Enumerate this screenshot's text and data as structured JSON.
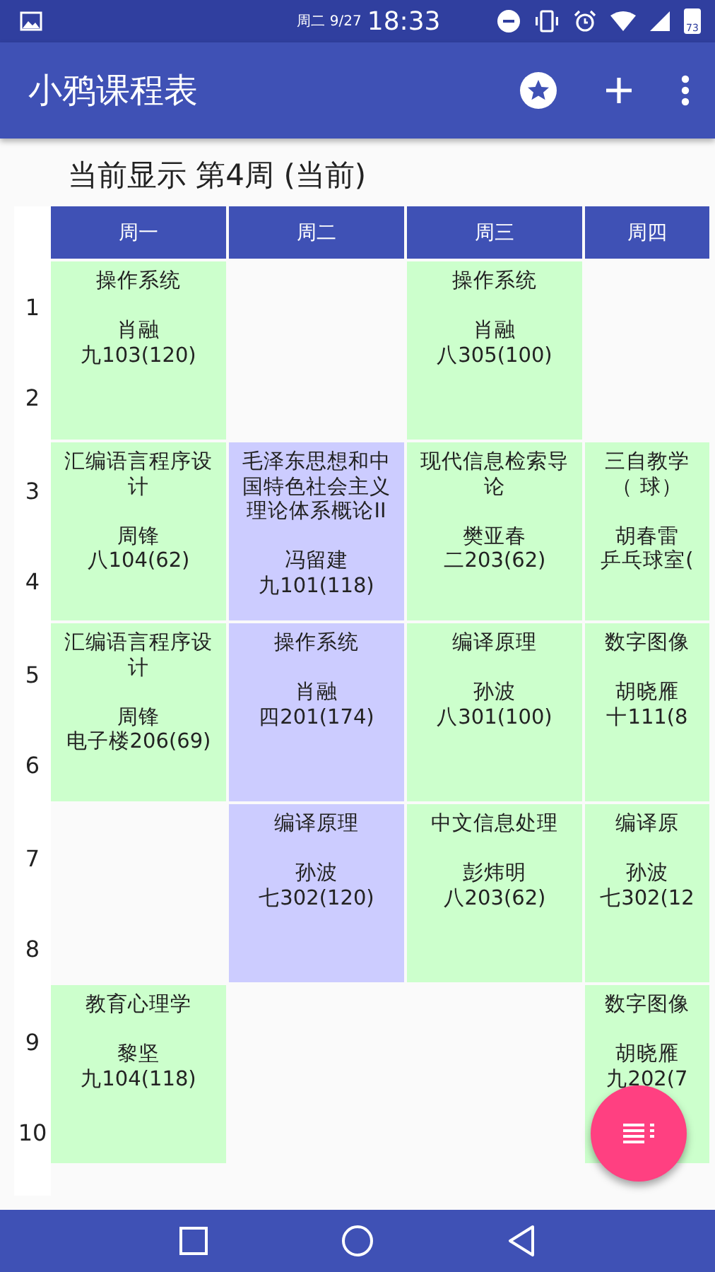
{
  "status_bar": {
    "date": "周二 9/27",
    "time": "18:33",
    "battery": "73"
  },
  "app_bar": {
    "title": "小鸦课程表"
  },
  "week_label": "当前显示 第4周 (当前)",
  "days": [
    "周一",
    "周二",
    "周三",
    "周四"
  ],
  "periods": [
    "1",
    "2",
    "3",
    "4",
    "5",
    "6",
    "7",
    "8",
    "9",
    "10"
  ],
  "blocks": [
    {
      "cells": [
        {
          "kind": "course",
          "color": "#ccffcc",
          "title": "操作系统",
          "teacher": "肖融",
          "room": "九103(120)"
        },
        {
          "kind": "empty"
        },
        {
          "kind": "course",
          "color": "#ccffcc",
          "title": "操作系统",
          "teacher": "肖融",
          "room": "八305(100)"
        },
        {
          "kind": "empty"
        }
      ]
    },
    {
      "cells": [
        {
          "kind": "course",
          "color": "#ccffcc",
          "title": "汇编语言程序设计",
          "teacher": "周锋",
          "room": "八104(62)"
        },
        {
          "kind": "course",
          "color": "#ccccff",
          "title": "毛泽东思想和中国特色社会主义理论体系概论II",
          "teacher": "冯留建",
          "room": "九101(118)"
        },
        {
          "kind": "course",
          "color": "#ccffcc",
          "title": "现代信息检索导论",
          "teacher": "樊亚春",
          "room": "二203(62)"
        },
        {
          "kind": "course",
          "color": "#ccffcc",
          "title": "三自教学（ 球）",
          "teacher": "胡春雷",
          "room": "乒乓球室("
        }
      ]
    },
    {
      "cells": [
        {
          "kind": "course",
          "color": "#ccffcc",
          "title": "汇编语言程序设计",
          "teacher": "周锋",
          "room": "电子楼206(69)"
        },
        {
          "kind": "course",
          "color": "#ccccff",
          "title": "操作系统",
          "teacher": "肖融",
          "room": "四201(174)"
        },
        {
          "kind": "course",
          "color": "#ccffcc",
          "title": "编译原理",
          "teacher": "孙波",
          "room": "八301(100)"
        },
        {
          "kind": "course",
          "color": "#ccffcc",
          "title": "数字图像",
          "teacher": "胡晓雁",
          "room": "十111(8"
        }
      ]
    },
    {
      "cells": [
        {
          "kind": "empty"
        },
        {
          "kind": "course",
          "color": "#ccccff",
          "title": "编译原理",
          "teacher": "孙波",
          "room": "七302(120)"
        },
        {
          "kind": "course",
          "color": "#ccffcc",
          "title": "中文信息处理",
          "teacher": "彭炜明",
          "room": "八203(62)"
        },
        {
          "kind": "course",
          "color": "#ccffcc",
          "title": "编译原",
          "teacher": "孙波",
          "room": "七302(12"
        }
      ]
    },
    {
      "cells": [
        {
          "kind": "course",
          "color": "#ccffcc",
          "title": "教育心理学",
          "teacher": "黎坚",
          "room": "九104(118)"
        },
        {
          "kind": "empty"
        },
        {
          "kind": "empty"
        },
        {
          "kind": "course",
          "color": "#ccffcc",
          "title": "数字图像",
          "teacher": "胡晓雁",
          "room": "九202(7"
        }
      ]
    }
  ]
}
